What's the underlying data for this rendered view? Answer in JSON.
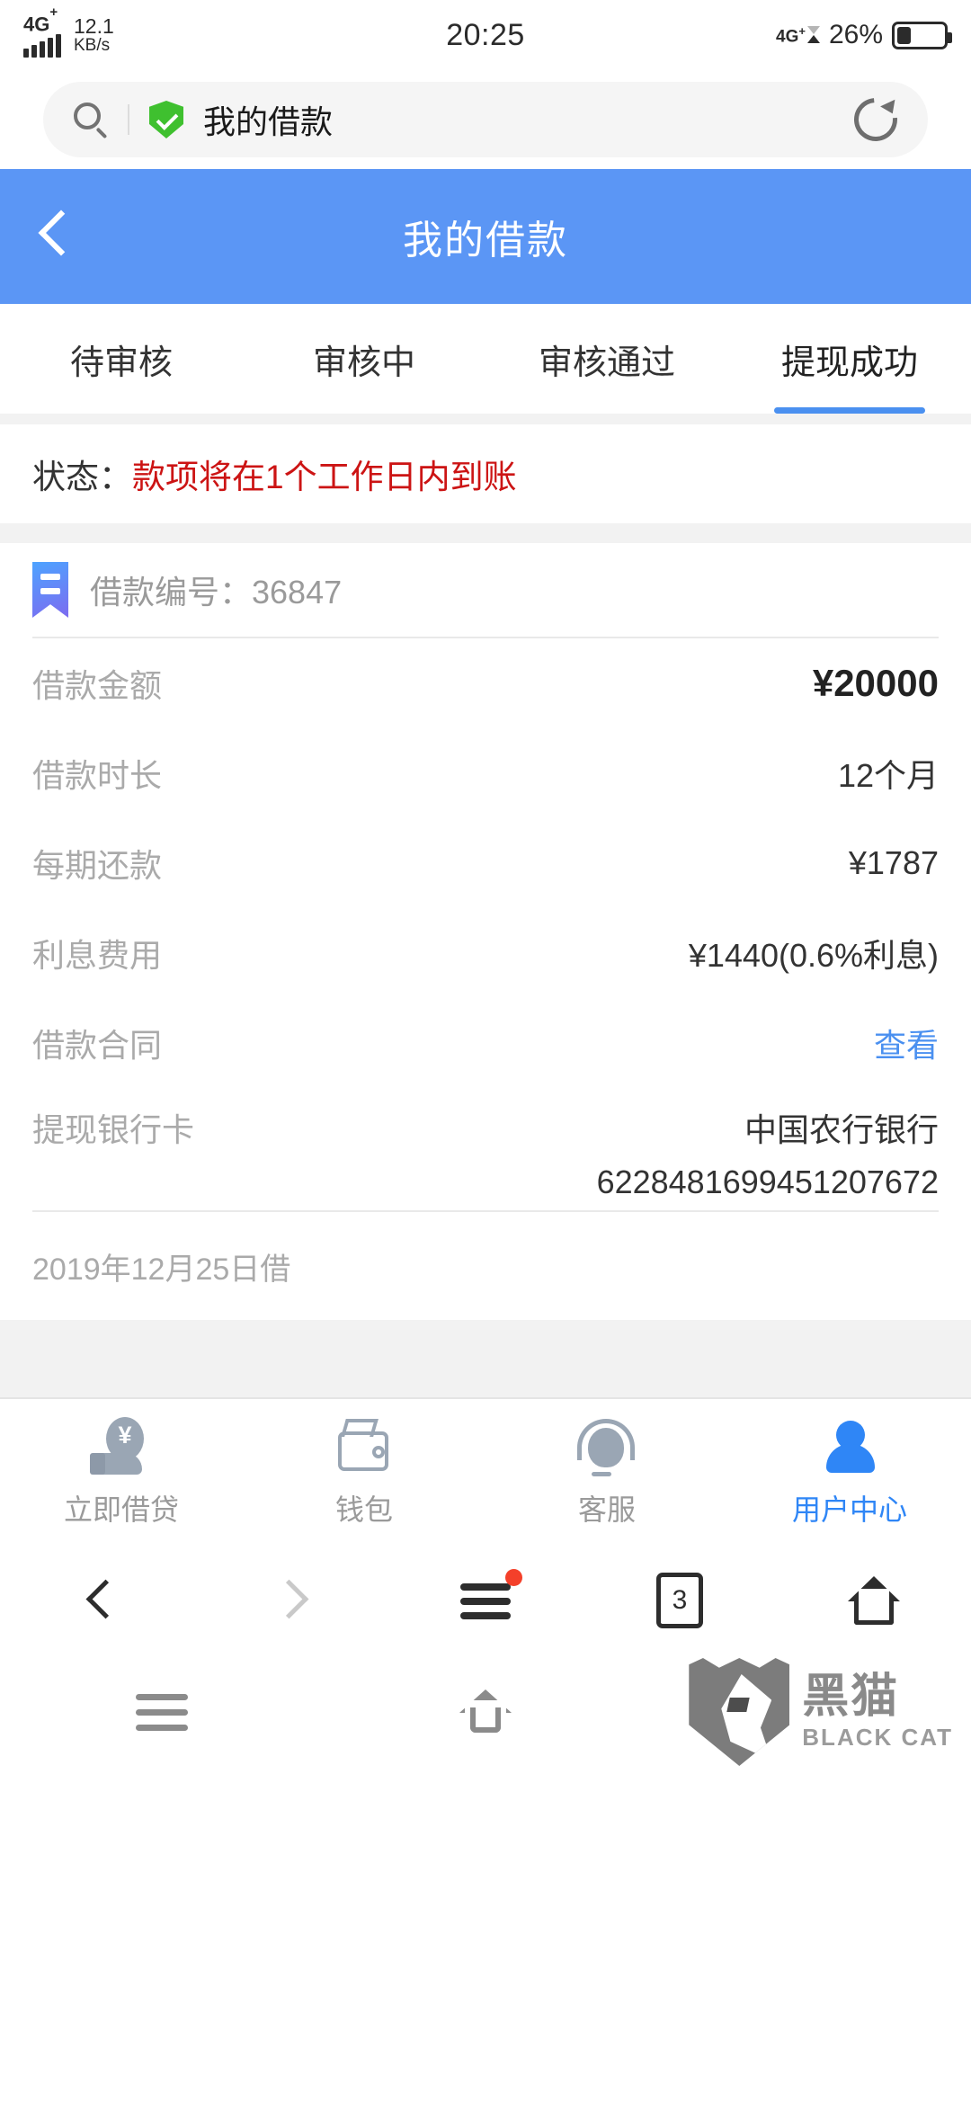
{
  "status_bar": {
    "network_label": "4G",
    "network_sup": "+",
    "speed_value": "12.1",
    "speed_unit": "KB/s",
    "clock": "20:25",
    "network_label_right": "4G",
    "network_sup_right": "+",
    "battery_percent": "26%"
  },
  "browser": {
    "search_title": "我的借款",
    "shield_icon": "green-shield-check-icon",
    "search_icon": "search-icon",
    "reload_icon": "reload-icon",
    "nav": {
      "back_icon": "chevron-left-icon",
      "forward_icon": "chevron-right-icon",
      "menu_icon": "hamburger-menu-icon",
      "tab_count": "3",
      "home_icon": "home-icon"
    }
  },
  "header": {
    "title": "我的借款",
    "back_icon": "chevron-left-icon",
    "bg_color": "#5b96f5"
  },
  "tabs": [
    {
      "label": "待审核",
      "active": false
    },
    {
      "label": "审核中",
      "active": false
    },
    {
      "label": "审核通过",
      "active": false
    },
    {
      "label": "提现成功",
      "active": true
    }
  ],
  "status": {
    "label": "状态：",
    "value": "款项将在1个工作日内到账",
    "value_color": "#cc1414"
  },
  "loan": {
    "order_icon": "bookmark-icon",
    "order_text": "借款编号：36847",
    "rows": [
      {
        "key": "借款金额",
        "value": "¥20000",
        "style": "strong"
      },
      {
        "key": "借款时长",
        "value": "12个月",
        "style": "normal"
      },
      {
        "key": "每期还款",
        "value": "¥1787",
        "style": "normal"
      },
      {
        "key": "利息费用",
        "value": "¥1440(0.6%利息)",
        "style": "normal"
      },
      {
        "key": "借款合同",
        "value": "查看",
        "style": "link"
      }
    ],
    "bank": {
      "key": "提现银行卡",
      "bank_name": "中国农行银行",
      "card_number": "6228481699451207672"
    },
    "date": "2019年12月25日借"
  },
  "bottom_tabbar": [
    {
      "label": "立即借贷",
      "icon": "hand-money-icon",
      "active": false
    },
    {
      "label": "钱包",
      "icon": "wallet-icon",
      "active": false
    },
    {
      "label": "客服",
      "icon": "customer-service-icon",
      "active": false
    },
    {
      "label": "用户中心",
      "icon": "user-icon",
      "active": true
    }
  ],
  "system_nav": {
    "menu_icon": "menu-icon",
    "home_icon": "home-icon"
  },
  "watermark": {
    "cn": "黑猫",
    "en": "BLACK CAT"
  }
}
